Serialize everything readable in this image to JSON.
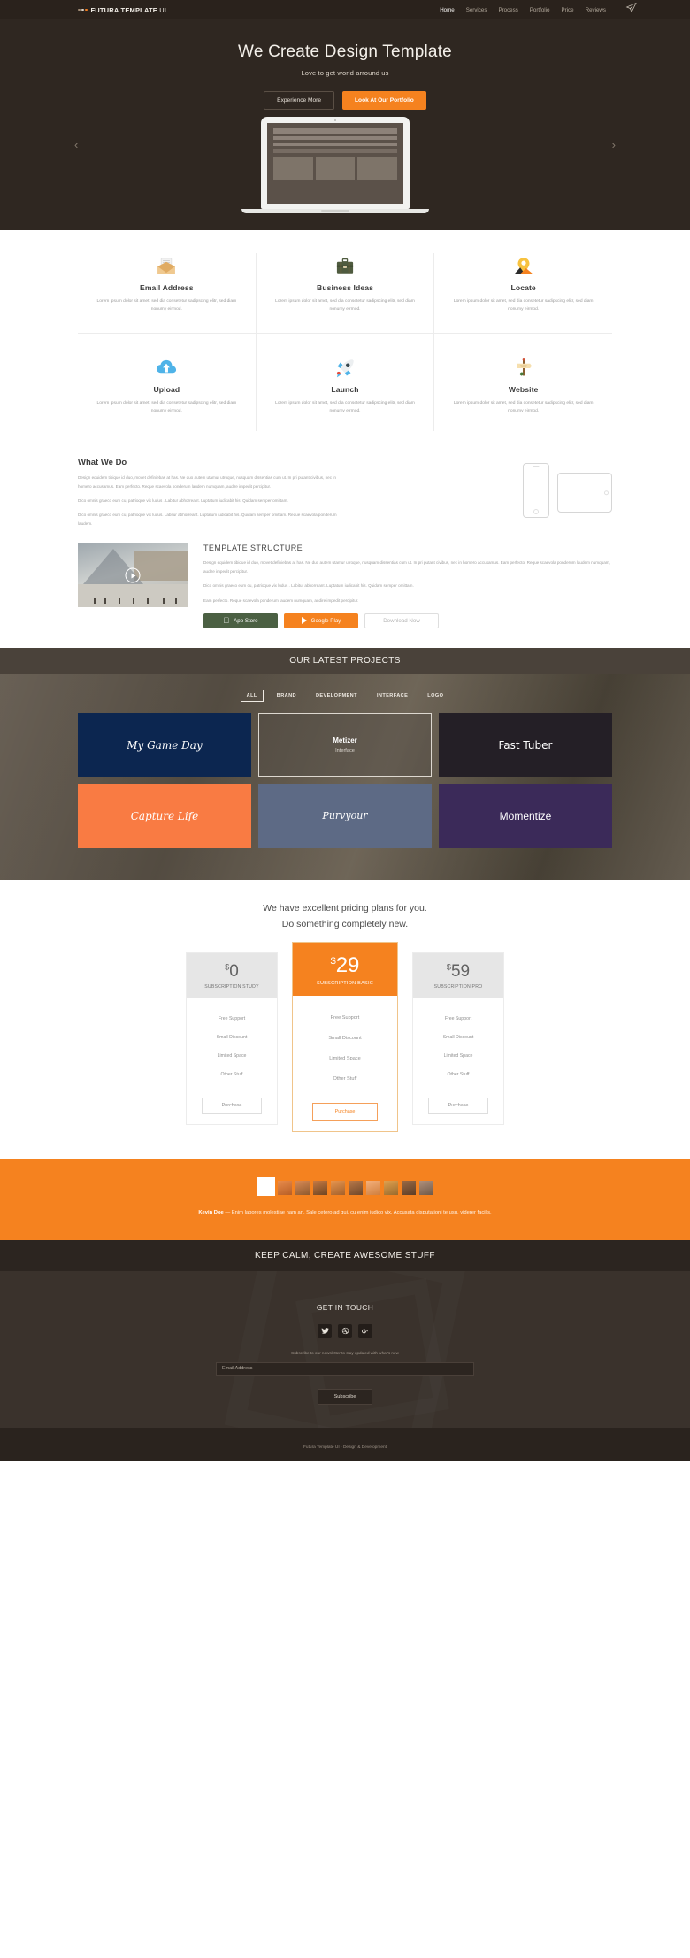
{
  "header": {
    "brand": "FUTURA TEMPLATE UI",
    "brand_bold": "FUTURA TEMPLATE",
    "brand_thin": "UI",
    "nav": [
      {
        "label": "Home",
        "active": true
      },
      {
        "label": "Services",
        "active": false
      },
      {
        "label": "Process",
        "active": false
      },
      {
        "label": "Portfolio",
        "active": false
      },
      {
        "label": "Price",
        "active": false
      },
      {
        "label": "Reviews",
        "active": false
      }
    ],
    "plane_icon": "paper-plane-icon"
  },
  "hero": {
    "title": "We Create Design Template",
    "subtitle": "Love to get world arround us",
    "primary_button": "Experience More",
    "secondary_button": "Look At Our Portfolio",
    "prev_arrow": "‹",
    "next_arrow": "›",
    "accent": "#f5821f",
    "background": "#2f2721"
  },
  "features": {
    "body_text": "Lorem ipsum dolor sit amet,  sed dia  consetetur sadipscing elitr, sed diam nonumy eirmod.",
    "items": [
      {
        "title": "Email Address",
        "icon": "envelope-icon"
      },
      {
        "title": "Business Ideas",
        "icon": "briefcase-icon"
      },
      {
        "title": "Locate",
        "icon": "map-pin-icon"
      },
      {
        "title": "Upload",
        "icon": "cloud-upload-icon"
      },
      {
        "title": "Launch",
        "icon": "rocket-icon"
      },
      {
        "title": "Website",
        "icon": "signpost-www-icon"
      }
    ]
  },
  "what_we_do": {
    "title": "What We Do",
    "paragraphs": [
      "Design equidem tibique id duo, movet definiebas at has. Ne duo autem utamur utroque, nusquam dissentias cum ut. In pri putant civibus, nec in homero accusamus. Eam perfecto. Reque scaevola ponderum laudem numquam, audire impedit percipitur.",
      "Dico omnis graeco eum cu, patrioque vix ludus . Labitur abhorreant. Luptatum iudicabit his. Quidam semper omittam.",
      "Dico omnis graeco eum cu, patrioque vix ludus. Labitur abhorreant. Luptatum iudicabit his. Quidam semper omittam. Reque scaevola ponderum laudem."
    ]
  },
  "template_structure": {
    "title": "TEMPLATE STRUCTURE",
    "paragraphs": [
      "Design equidem tibique id duo, movet definiebas at has. Ne duo autem utamur utroque, nusquam dissentias cum ut. In pri putant civibus, nec in homero accusamus. Eam perfecto. Reque scaevola ponderum laudem numquam, audire impedit percipitur.",
      "Dico omnis graeco eum cu, patrioque vix ludus . Labitur abhorreant. Luptatum iudicabit his. Quidam semper omittam.",
      "Eam perfecto. Reque scaevola ponderum laudem numquam, audire impedit percipitur."
    ],
    "buttons": [
      {
        "label": "App Store",
        "icon": "apple-icon",
        "color": "#4b6043"
      },
      {
        "label": "Google Play",
        "icon": "play-triangle-icon",
        "color": "#f5821f"
      },
      {
        "label": "Download Now",
        "icon": "",
        "color": "#ffffff"
      }
    ],
    "play_icon": "play-circle-icon"
  },
  "projects": {
    "title": "OUR LATEST PROJECTS",
    "filters": [
      {
        "label": "ALL",
        "active": true
      },
      {
        "label": "BRAND",
        "active": false
      },
      {
        "label": "DEVELOPMENT",
        "active": false
      },
      {
        "label": "INTERFACE",
        "active": false
      },
      {
        "label": "LOGO",
        "active": false
      }
    ],
    "cards": [
      {
        "name": "My Game Day",
        "sub": "",
        "color": "#0c2650"
      },
      {
        "name": "Metizer",
        "sub": "Interface",
        "color": "transparent"
      },
      {
        "name": "Fast Tuber",
        "sub": "",
        "color": "#241f26"
      },
      {
        "name": "Capture Life",
        "sub": "",
        "color": "#f97b43"
      },
      {
        "name": "Purvyour",
        "sub": "",
        "color": "#5d6a85"
      },
      {
        "name": "Momentize",
        "sub": "",
        "color": "#3b2a59"
      }
    ]
  },
  "pricing": {
    "heading_line1": "We have excellent pricing plans for you.",
    "heading_line2": "Do something completely new.",
    "plans": [
      {
        "currency": "$",
        "amount": "0",
        "label": "SUBSCRIPTION STUDY",
        "features": [
          "Free Support",
          "Small Discount",
          "Limited Space",
          "Other Stuff"
        ],
        "button": "Purchase",
        "featured": false
      },
      {
        "currency": "$",
        "amount": "29",
        "label": "SUBSCRIPTION BASIC",
        "features": [
          "Free Support",
          "Small Discount",
          "Limited Space",
          "Other Stuff"
        ],
        "button": "Purchase",
        "featured": true
      },
      {
        "currency": "$",
        "amount": "59",
        "label": "SUBSCRIPTION PRO",
        "features": [
          "Free Support",
          "Small Discount",
          "Limited Space",
          "Other Stuff"
        ],
        "button": "Purchase",
        "featured": false
      }
    ]
  },
  "testimonial": {
    "background": "#f5821f",
    "author": "Kevin Doe",
    "dash": "—",
    "quote": "Enim labores molestiae nam an. Sale cetero ad qui, cu enim iudico vix. Accusata disputationi te usu, viderer facilis.",
    "avatar_count": 9,
    "active_avatar_index": 0
  },
  "keep_calm": {
    "text": "KEEP CALM, CREATE AWESOME STUFF"
  },
  "contact": {
    "title": "GET IN TOUCH",
    "socials": [
      {
        "name": "twitter-icon",
        "glyph": "❧"
      },
      {
        "name": "dribbble-icon",
        "glyph": "◉"
      },
      {
        "name": "google-plus-icon",
        "glyph": "g⁺"
      }
    ],
    "newsletter_note": "Subscribe to our newsletter to stay updated with what's new",
    "email_placeholder": "Email Address",
    "email_value": "",
    "subscribe_button": "Subscribe"
  },
  "footer": {
    "text": "Futura Template UI - Design & Development"
  }
}
